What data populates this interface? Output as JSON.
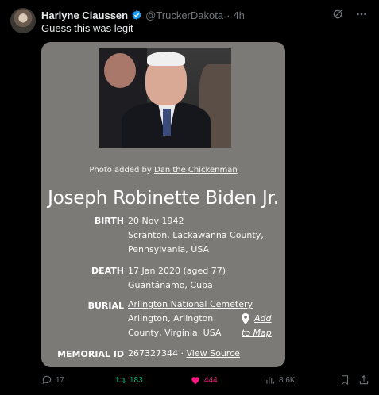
{
  "tweet": {
    "author_name": "Harlyne Claussen",
    "handle": "@TruckerDakota",
    "separator": "·",
    "time": "4h",
    "text": "Guess this was legit"
  },
  "card": {
    "photo_credit_prefix": "Photo added by",
    "photo_credit_user": "Dan the Chickenman",
    "full_name": "Joseph Robinette Biden Jr.",
    "birth": {
      "label": "BIRTH",
      "date": "20 Nov 1942",
      "place_line1": "Scranton, Lackawanna County,",
      "place_line2": "Pennsylvania, USA"
    },
    "death": {
      "label": "DEATH",
      "date": "17 Jan 2020 (aged 77)",
      "place": "Guantánamo, Cuba"
    },
    "burial": {
      "label": "BURIAL",
      "cemetery": "Arlington National Cemetery",
      "place_line1": "Arlington, Arlington",
      "place_line2": "County, Virginia, USA",
      "map_line1": "Add",
      "map_line2": "to Map"
    },
    "memorial": {
      "label": "MEMORIAL ID",
      "id": "267327344",
      "separator": "·",
      "source_link": "View Source"
    }
  },
  "actions": {
    "replies": "17",
    "reposts": "183",
    "likes": "444",
    "views": "8.6K"
  },
  "colors": {
    "verified": "#1d9bf0",
    "repost": "#00ba7c",
    "like": "#f91880",
    "card_bg": "#7b7a76"
  }
}
